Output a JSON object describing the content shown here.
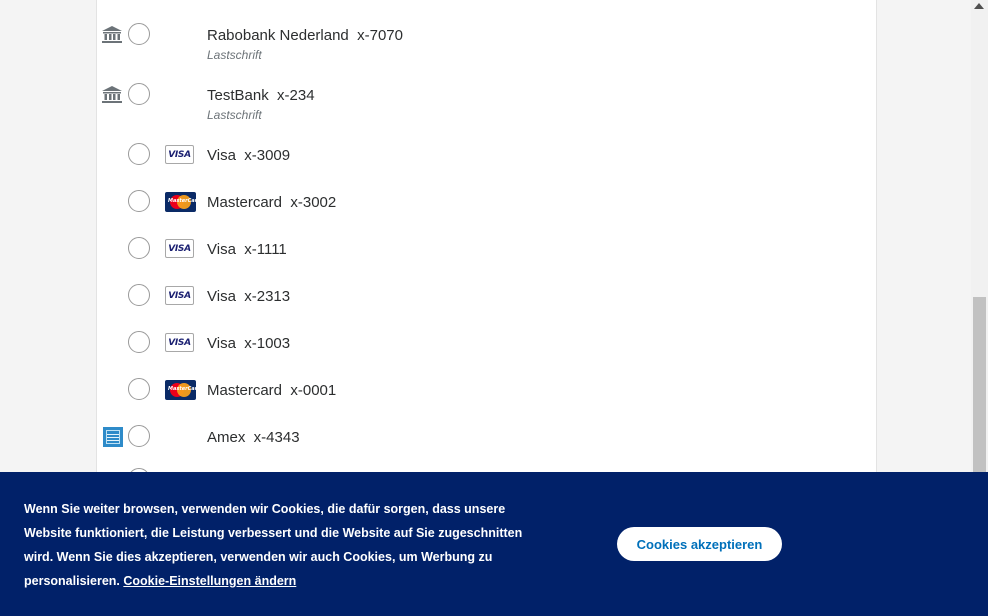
{
  "payment_methods": [
    {
      "name": "Rabobank Nederland  x-7070",
      "subtitle": "Lastschrift",
      "icon": "bank-icon"
    },
    {
      "name": "TestBank  x-234",
      "subtitle": "Lastschrift",
      "icon": "bank-icon"
    },
    {
      "name": "Visa  x-3009",
      "icon": "visa-icon",
      "brand_text": "VISA"
    },
    {
      "name": "Mastercard  x-3002",
      "icon": "mastercard-icon",
      "brand_text": "MasterCard"
    },
    {
      "name": "Visa  x-1111",
      "icon": "visa-icon",
      "brand_text": "VISA"
    },
    {
      "name": "Visa  x-2313",
      "icon": "visa-icon",
      "brand_text": "VISA"
    },
    {
      "name": "Visa  x-1003",
      "icon": "visa-icon",
      "brand_text": "VISA"
    },
    {
      "name": "Mastercard  x-0001",
      "icon": "mastercard-icon",
      "brand_text": "MasterCard"
    },
    {
      "name": "Amex  x-4343",
      "icon": "amex-icon"
    }
  ],
  "cookie_banner": {
    "text": "Wenn Sie weiter browsen, verwenden wir Cookies, die dafür sorgen, dass unsere Website funktioniert, die Leistung verbessert und die Website auf Sie zugeschnitten wird. Wenn Sie dies akzeptieren, verwenden wir auch Cookies, um Werbung zu personalisieren. ",
    "settings_link": "Cookie-Einstellungen ändern",
    "accept_button": "Cookies akzeptieren"
  },
  "colors": {
    "banner_bg": "#012169",
    "accept_text": "#0070ba",
    "visa_blue": "#1a1f71",
    "bank_gray": "#6c7378"
  }
}
